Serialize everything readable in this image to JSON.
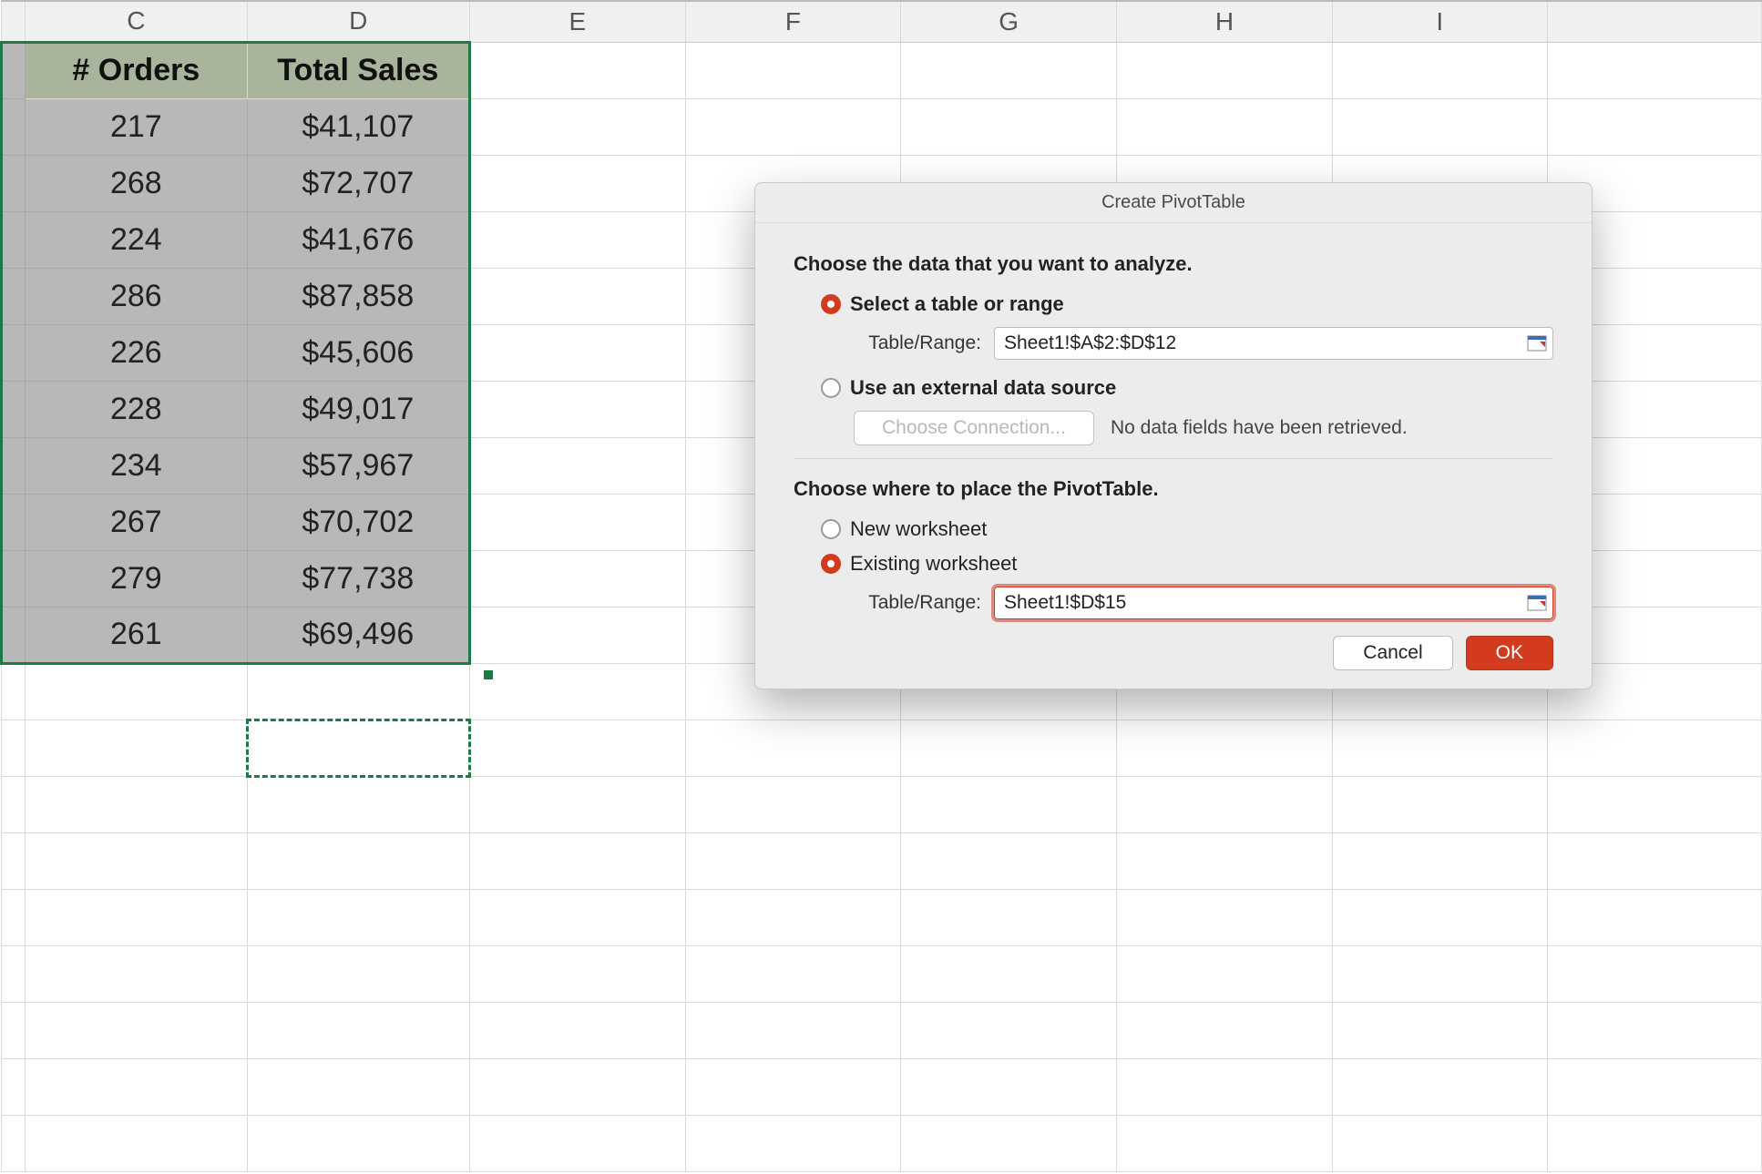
{
  "columns": [
    "C",
    "D",
    "E",
    "F",
    "G",
    "H",
    "I"
  ],
  "table": {
    "headers": [
      "# Orders",
      "Total Sales"
    ],
    "rows": [
      [
        "217",
        "$41,107"
      ],
      [
        "268",
        "$72,707"
      ],
      [
        "224",
        "$41,676"
      ],
      [
        "286",
        "$87,858"
      ],
      [
        "226",
        "$45,606"
      ],
      [
        "228",
        "$49,017"
      ],
      [
        "234",
        "$57,967"
      ],
      [
        "267",
        "$70,702"
      ],
      [
        "279",
        "$77,738"
      ],
      [
        "261",
        "$69,496"
      ]
    ]
  },
  "dialog": {
    "title": "Create PivotTable",
    "section1_heading": "Choose the data that you want to analyze.",
    "opt_select_range_label": "Select a table or range",
    "opt_external_label": "Use an external data source",
    "table_range_label": "Table/Range:",
    "table_range_value": "Sheet1!$A$2:$D$12",
    "choose_connection_label": "Choose Connection...",
    "no_data_fields_msg": "No data fields have been retrieved.",
    "section2_heading": "Choose where to place the PivotTable.",
    "opt_new_ws_label": "New worksheet",
    "opt_existing_ws_label": "Existing worksheet",
    "dest_range_label": "Table/Range:",
    "dest_range_value": "Sheet1!$D$15",
    "cancel_label": "Cancel",
    "ok_label": "OK"
  }
}
